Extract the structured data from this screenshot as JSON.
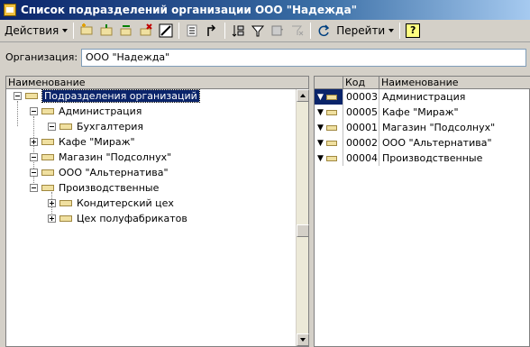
{
  "window": {
    "title": "Список подразделений организации ООО \"Надежда\""
  },
  "toolbar": {
    "actions_label": "Действия",
    "goto_label": "Перейти",
    "help_label": "?"
  },
  "organization": {
    "label": "Организация:",
    "value": "ООО \"Надежда\""
  },
  "tree": {
    "header": "Наименование",
    "root": "Подразделения организаций",
    "items": [
      {
        "label": "Администрация"
      },
      {
        "label": "Бухгалтерия"
      },
      {
        "label": "Кафе \"Мираж\""
      },
      {
        "label": "Магазин \"Подсолнух\""
      },
      {
        "label": "ООО \"Альтернатива\""
      },
      {
        "label": "Производственные"
      },
      {
        "label": "Кондитерский цех"
      },
      {
        "label": "Цех полуфабрикатов"
      }
    ]
  },
  "list": {
    "columns": {
      "code": "Код",
      "name": "Наименование"
    },
    "rows": [
      {
        "code": "00003",
        "name": "Администрация"
      },
      {
        "code": "00005",
        "name": "Кафе \"Мираж\""
      },
      {
        "code": "00001",
        "name": "Магазин \"Подсолнух\""
      },
      {
        "code": "00002",
        "name": "ООО \"Альтернатива\""
      },
      {
        "code": "00004",
        "name": "Производственные"
      }
    ]
  },
  "colors": {
    "selection": "#0a246a",
    "titlebar_start": "#0a246a",
    "titlebar_end": "#a6caf0",
    "folder": "#f0e0a0"
  }
}
